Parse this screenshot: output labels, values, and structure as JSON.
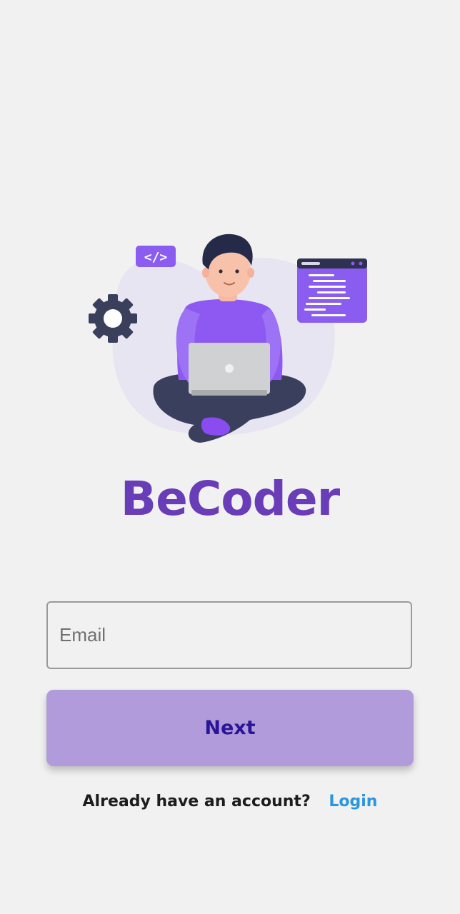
{
  "app": {
    "brand_name": "BeCoder",
    "brand_color": "#6a3db8"
  },
  "illustration": {
    "description_icon": "developer-with-laptop-illustration",
    "code_badge_text": "</>"
  },
  "form": {
    "email_placeholder": "Email",
    "next_label": "Next",
    "button_color": "#b29bda",
    "button_text_color": "#2a1596"
  },
  "footer": {
    "prompt": "Already have an account?",
    "login_label": "Login",
    "login_color": "#2a96e0"
  }
}
